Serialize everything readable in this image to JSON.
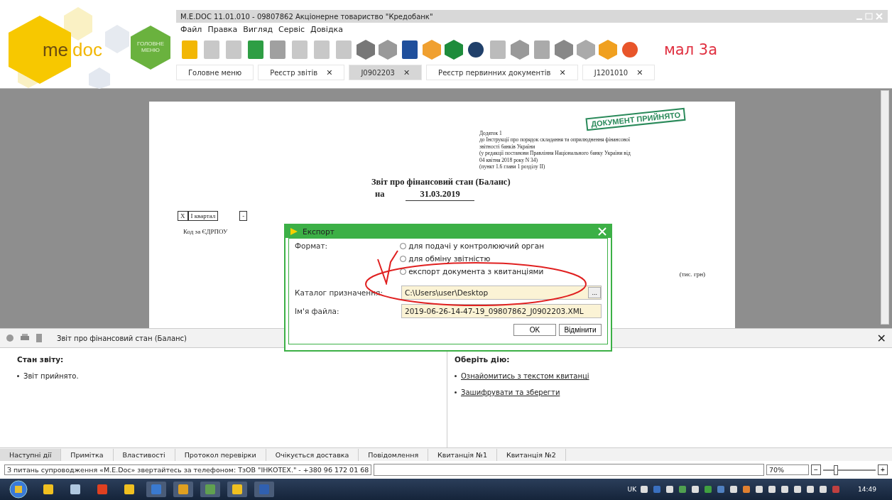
{
  "window": {
    "title": "M.E.DOC 11.01.010 - 09807862 Акціонерне товариство \"Кредобанк\""
  },
  "logo": {
    "part_1": "me",
    "part_2": "doc"
  },
  "main_menu_button": {
    "label": "ГОЛОВНЕ МЕНЮ"
  },
  "menu": [
    "Файл",
    "Правка",
    "Вигляд",
    "Сервіс",
    "Довідка"
  ],
  "annotation_label": "мал 3а",
  "tabs": [
    {
      "label": "Головне меню",
      "selected": false
    },
    {
      "label": "Реєстр звітів",
      "close": "✕",
      "selected": false
    },
    {
      "label": "J0902203",
      "close": "✕",
      "selected": true
    },
    {
      "label": "Реєстр первинних документів",
      "close": "✕",
      "selected": false
    },
    {
      "label": "J1201010",
      "close": "✕",
      "selected": false
    }
  ],
  "document": {
    "notes": [
      "Додаток 1",
      "до Інструкції про порядок складання та оприлюднення фінансової",
      "звітності банків України",
      "(у редакції постанови Правління Національного банку України від",
      "04 квітня 2018 року N 34)",
      "(пункт 1.6 глави 1 розділу II)"
    ],
    "stamp": "ДОКУМЕНТ ПРИЙНЯТО",
    "title": "Звіт про фінансовий стан (Баланс)",
    "date_prefix": "на",
    "date": "31.03.2019",
    "period_mark": "X",
    "period": "I квартал",
    "dash": "-",
    "code_label": "Код за ЄДРПОУ",
    "units": "(тис. грн)"
  },
  "dialog": {
    "title": "Експорт",
    "format_label": "Формат:",
    "options": [
      {
        "label": "для подачі у контролюючий орган",
        "selected": false
      },
      {
        "label": "для обміну звітністю",
        "selected": false
      },
      {
        "label": "експорт документа з квитанціями",
        "selected": false
      }
    ],
    "folder_label": "Каталог призначення:",
    "folder_value": "C:\\Users\\user\\Desktop",
    "browse": "...",
    "file_label": "Ім'я файла:",
    "file_value": "2019-06-26-14-47-19_09807862_J0902203.XML",
    "buttons": [
      "OK",
      "Відмінити"
    ]
  },
  "details": {
    "title": "Звіт про фінансовий стан (Баланс)",
    "close": "✕",
    "status_heading": "Стан звіту:",
    "status_items": [
      "Звіт прийнято."
    ],
    "actions_heading": "Оберіть дію:",
    "actions": [
      "Ознайомитись з текстом квитанці",
      "Зашифрувати та зберегти"
    ]
  },
  "bottom_tabs": [
    {
      "label": "Наступні дії",
      "selected": true
    },
    {
      "label": "Примітка",
      "selected": false
    },
    {
      "label": "Властивості",
      "selected": false
    },
    {
      "label": "Протокол перевірки",
      "selected": false
    },
    {
      "label": "Очікується доставка",
      "selected": false
    },
    {
      "label": "Повідомлення",
      "selected": false
    },
    {
      "label": "Квитанція №1",
      "selected": false
    },
    {
      "label": "Квитанція №2",
      "selected": false
    }
  ],
  "status_bar": {
    "message": "З питань супроводження «M.E.Doc» звертайтесь за телефоном: ТзОВ \"ІНКОТЕХ.\" - +380 96 172 01 68",
    "zoom": "70%",
    "zoom_out": "−",
    "zoom_in": "+",
    "zoom_slider": {
      "level": 0.2
    }
  },
  "taskbar": {
    "language": "UK",
    "clock": "14:49"
  }
}
